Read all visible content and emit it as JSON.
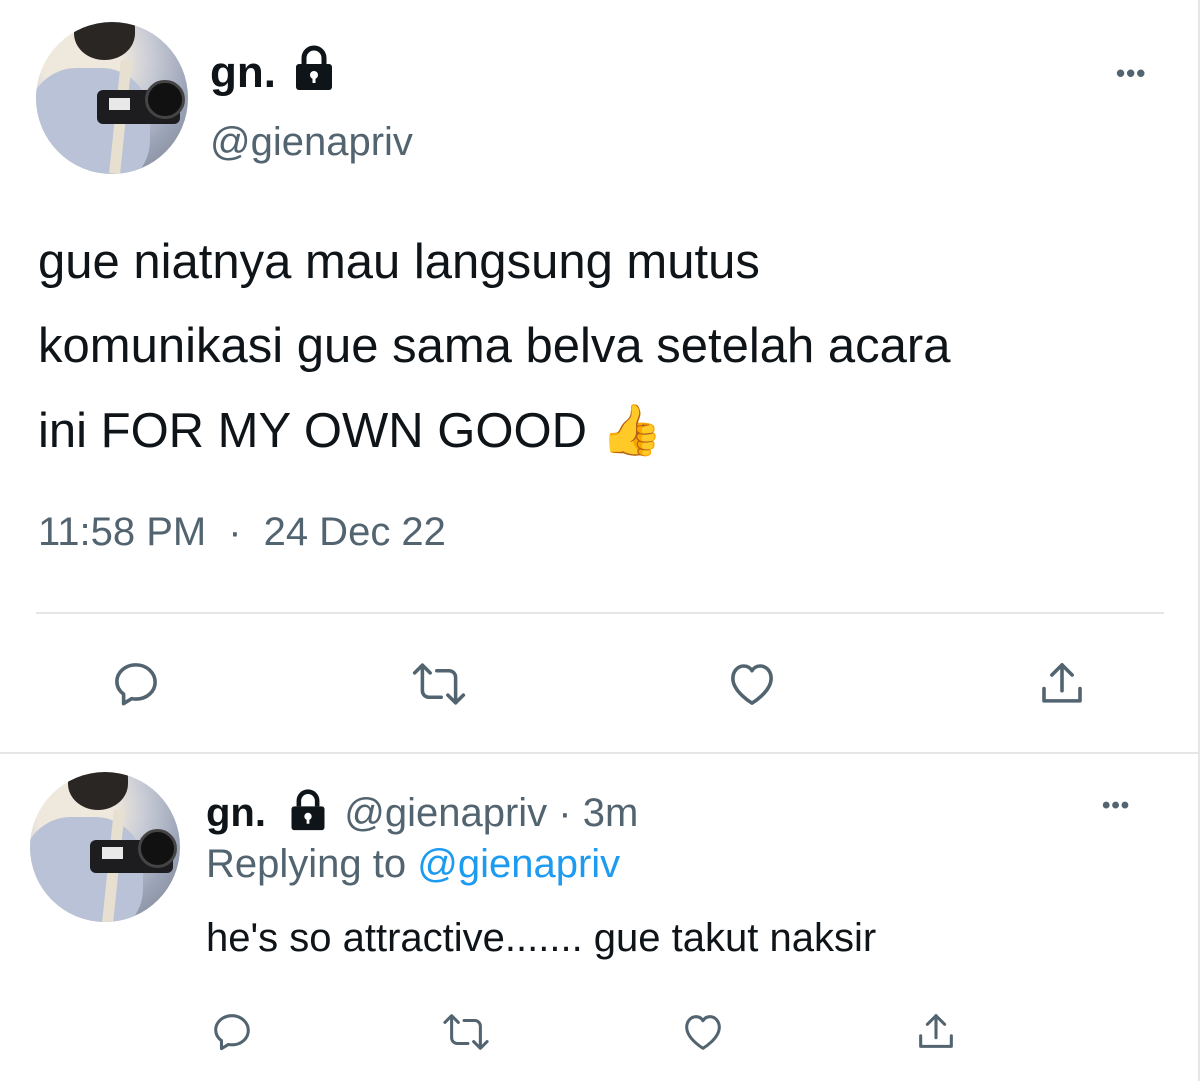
{
  "main_tweet": {
    "display_name": "gn.",
    "handle": "@gienapriv",
    "text_lines": [
      "gue niatnya mau langsung mutus",
      "komunikasi gue sama belva setelah acara",
      "ini FOR MY OWN GOOD"
    ],
    "emoji": "👍",
    "time": "11:58 PM",
    "separator": "·",
    "date": "24 Dec 22"
  },
  "reply_tweet": {
    "display_name": "gn.",
    "handle": "@gienapriv",
    "age": "· 3m",
    "replying_prefix": "Replying to",
    "replying_handle": "@gienapriv",
    "text": "he's so attractive....... gue takut naksir"
  },
  "more_label": "•••",
  "icons": {
    "reply": "reply-icon",
    "retweet": "retweet-icon",
    "like": "heart-icon",
    "share": "share-icon",
    "lock": "lock-icon",
    "more": "more-icon"
  },
  "colors": {
    "text": "#0f1419",
    "secondary": "#536471",
    "link": "#1d9bf0",
    "border": "#e6e6e6"
  }
}
